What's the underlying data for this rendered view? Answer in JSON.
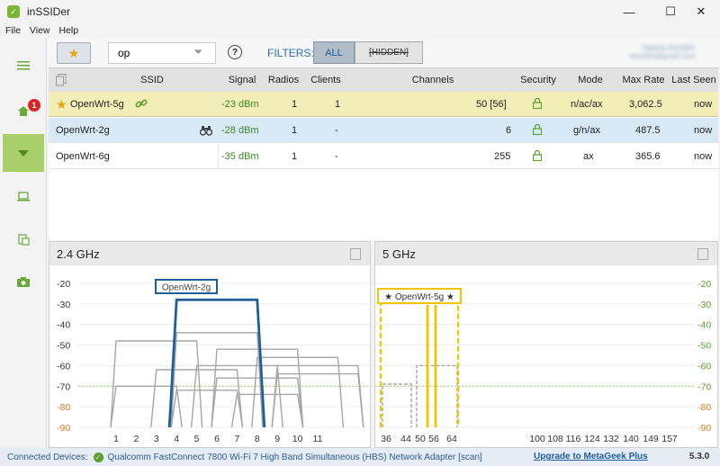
{
  "window": {
    "title": "inSSIDer",
    "minimize": "—",
    "maximize": "☐",
    "close": "✕"
  },
  "menu": [
    "File",
    "View",
    "Help"
  ],
  "sidebar": {
    "home_badge": "1"
  },
  "toolbar": {
    "search_value": "op",
    "filters_label": "FILTERS:",
    "filter_all": "ALL",
    "filter_hidden": "[HIDDEN]",
    "account_name": "Valeriy Kozlitin",
    "account_email": "vkozlitin@gmail.com"
  },
  "table": {
    "headers": [
      "SSID",
      "Signal",
      "Radios",
      "Clients",
      "Channels",
      "Security",
      "Mode",
      "Max Rate",
      "Last Seen"
    ],
    "rows": [
      {
        "ssid": "OpenWrt-5g",
        "signal": "-23 dBm",
        "radios": "1",
        "clients": "1",
        "channels": "50 [56]",
        "mode": "n/ac/ax",
        "max_rate": "3,062.5",
        "last_seen": "now"
      },
      {
        "ssid": "OpenWrt-2g",
        "signal": "-28 dBm",
        "radios": "1",
        "clients": "-",
        "channels": "6",
        "mode": "g/n/ax",
        "max_rate": "487.5",
        "last_seen": "now"
      },
      {
        "ssid": "OpenWrt-6g",
        "signal": "-35 dBm",
        "radios": "1",
        "clients": "-",
        "channels": "255",
        "mode": "ax",
        "max_rate": "365.6",
        "last_seen": "now"
      }
    ]
  },
  "panels": {
    "ghz24": {
      "title": "2.4 GHz",
      "label": "OpenWrt-2g"
    },
    "ghz5": {
      "title": "5 GHz",
      "label": "★ OpenWrt-5g ★"
    }
  },
  "chart_data": [
    {
      "type": "area",
      "title": "2.4 GHz",
      "ylim": [
        -90,
        -20
      ],
      "y_ticks": [
        "-20",
        "-30",
        "-40",
        "-50",
        "-60",
        "-70",
        "-80",
        "-90"
      ],
      "x_ticks": [
        "1",
        "2",
        "3",
        "4",
        "5",
        "6",
        "7",
        "8",
        "9",
        "10",
        "11"
      ],
      "x_tick_values": [
        1,
        2,
        3,
        4,
        5,
        6,
        7,
        8,
        9,
        10,
        11
      ],
      "highlight": {
        "name": "OpenWrt-2g",
        "channel_from": 4,
        "channel_to": 8,
        "signal": -28
      },
      "others": [
        {
          "from": 1,
          "to": 5,
          "signal": -48
        },
        {
          "from": 4,
          "to": 8,
          "signal": -44
        },
        {
          "from": 6,
          "to": 10,
          "signal": -52
        },
        {
          "from": 8,
          "to": 12,
          "signal": -56
        },
        {
          "from": 5,
          "to": 9,
          "signal": -60
        },
        {
          "from": 9,
          "to": 13,
          "signal": -60
        },
        {
          "from": 3,
          "to": 7,
          "signal": -62
        },
        {
          "from": 9,
          "to": 13,
          "signal": -64
        },
        {
          "from": 6,
          "to": 10,
          "signal": -66
        },
        {
          "from": 1,
          "to": 4,
          "signal": -70
        },
        {
          "from": 4,
          "to": 7,
          "signal": -72
        },
        {
          "from": 7,
          "to": 10,
          "signal": -74
        }
      ]
    },
    {
      "type": "area",
      "title": "5 GHz",
      "ylim": [
        -90,
        -20
      ],
      "y_ticks": [
        "-20",
        "-30",
        "-40",
        "-50",
        "-60",
        "-70",
        "-80",
        "-90"
      ],
      "x_ticks": [
        "36",
        "44",
        "50",
        "56",
        "64",
        "100",
        "108",
        "116",
        "124",
        "132",
        "140",
        "149",
        "157"
      ],
      "highlight": {
        "name": "OpenWrt-5g",
        "signal": -23
      },
      "others": [
        {
          "from": "50",
          "to": "64",
          "signal": -60
        },
        {
          "from": "36",
          "to": "44",
          "signal": -69
        }
      ]
    }
  ],
  "status": {
    "label": "Connected Devices:",
    "adapter": "Qualcomm FastConnect 7800 Wi-Fi 7 High Band Simultaneous (HBS) Network Adapter [scan]",
    "upgrade": "Upgrade to MetaGeek Plus",
    "version": "5.3.0"
  },
  "colors": {
    "accent": "#7ab536",
    "highlight_24": "#1f5f99",
    "highlight_5": "#f2c400",
    "other": "#a5a5a5",
    "signal_green": "#3a8a20"
  }
}
